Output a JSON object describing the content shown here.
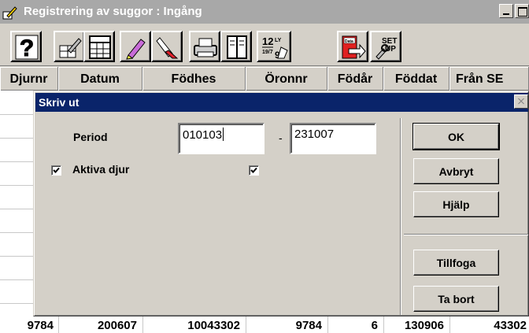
{
  "main_window": {
    "title": "Registrering av suggor : Ingång"
  },
  "toolbar": {
    "tools": [
      {
        "name": "help-icon",
        "glyph": "?"
      },
      {
        "name": "edit-pen-icon"
      },
      {
        "name": "calendar-grid-icon"
      },
      {
        "name": "highlighter-icon"
      },
      {
        "name": "eraser-icon"
      },
      {
        "name": "printer-icon"
      },
      {
        "name": "document-columns-icon"
      },
      {
        "name": "date-calc-icon",
        "text_top": "12",
        "text_sub": "19/7",
        "text_mid": "LY",
        "text_bot": "9"
      },
      {
        "name": "data-transfer-icon",
        "text": "Data"
      },
      {
        "name": "setup-icon",
        "text_top": "SET",
        "text_bot": "UP"
      }
    ]
  },
  "grid": {
    "columns": [
      "Djurnr",
      "Datum",
      "Födhes",
      "Öronnr",
      "Födår",
      "Föddat",
      "Från SE"
    ],
    "last_row": [
      "9784",
      "200607",
      "10043302",
      "9784",
      "6",
      "130906",
      "43302"
    ]
  },
  "dialog": {
    "title": "Skriv ut",
    "period_label": "Period",
    "period_from": "010103",
    "period_separator": "-",
    "period_to": "231007",
    "aktiva_label": "Aktiva djur",
    "aktiva_checked": true,
    "second_checked": true,
    "buttons": {
      "ok": "OK",
      "cancel": "Avbryt",
      "help": "Hjälp",
      "add": "Tillfoga",
      "remove": "Ta bort"
    }
  },
  "colors": {
    "active_title": "#0a246a",
    "inactive_title": "#a8a8a8",
    "face": "#d4d0c8"
  }
}
